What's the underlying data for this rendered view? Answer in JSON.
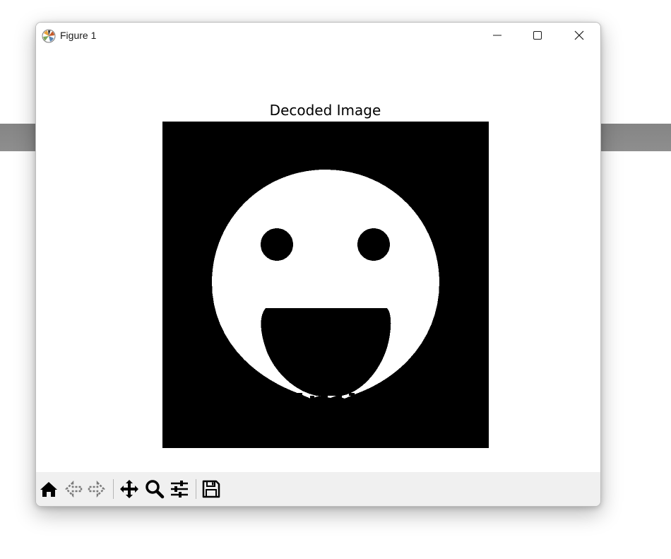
{
  "window": {
    "title": "Figure 1"
  },
  "figure": {
    "title": "Decoded Image"
  },
  "titlebar_buttons": [
    "minimize-icon",
    "maximize-icon",
    "close-icon"
  ],
  "toolbar": {
    "buttons": [
      "home-icon",
      "back-arrow-icon",
      "forward-arrow-icon",
      "pan-move-icon",
      "zoom-magnifier-icon",
      "configure-subplots-icon",
      "save-floppy-icon"
    ]
  },
  "image": {
    "description_colors": {
      "background": "#000000",
      "foreground": "#ffffff"
    }
  }
}
